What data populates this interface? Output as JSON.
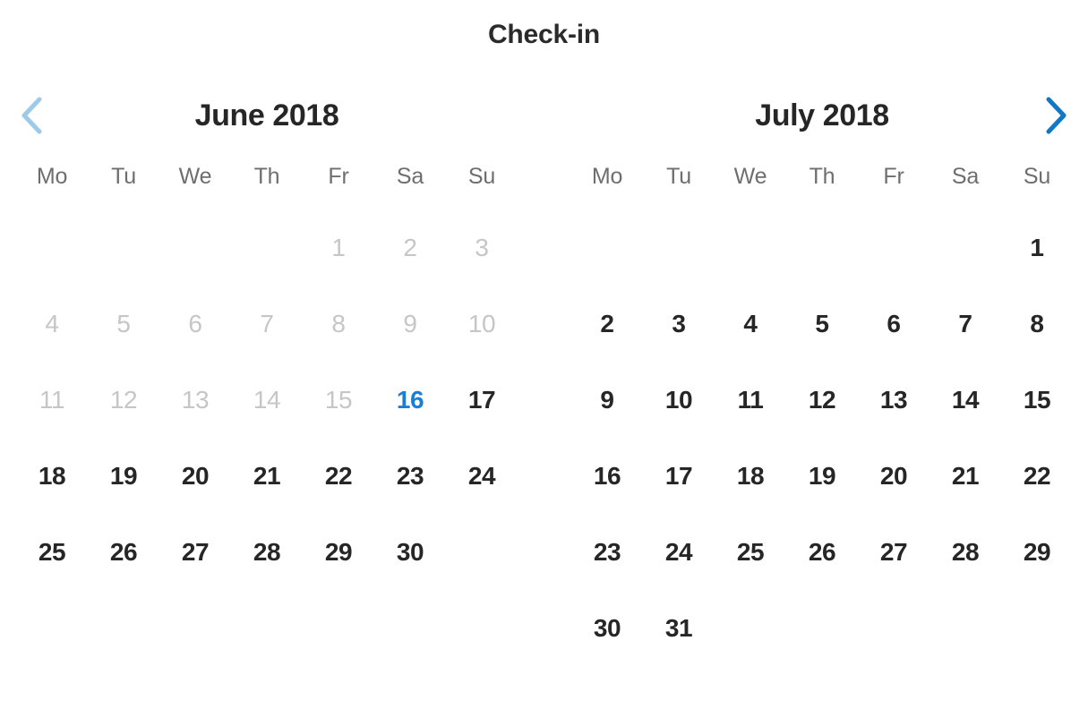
{
  "title": "Check-in",
  "colors": {
    "text_default": "#262626",
    "text_disabled": "#c6c6c6",
    "text_weekday": "#6e6e6e",
    "today_blue": "#1a7ed6",
    "arrow_next_blue": "#1179c3",
    "arrow_prev_blue": "#9ecae9",
    "background": "#ffffff"
  },
  "nav": {
    "prev": {
      "icon": "chevron-left-icon",
      "label": "Previous month",
      "enabled": false
    },
    "next": {
      "icon": "chevron-right-icon",
      "label": "Next month",
      "enabled": true
    }
  },
  "weekdays": [
    "Mo",
    "Tu",
    "We",
    "Th",
    "Fr",
    "Sa",
    "Su"
  ],
  "months": [
    {
      "caption": "June 2018",
      "weeks": [
        [
          {
            "label": "",
            "state": "empty"
          },
          {
            "label": "",
            "state": "empty"
          },
          {
            "label": "",
            "state": "empty"
          },
          {
            "label": "",
            "state": "empty"
          },
          {
            "label": "1",
            "state": "disabled"
          },
          {
            "label": "2",
            "state": "disabled"
          },
          {
            "label": "3",
            "state": "disabled"
          }
        ],
        [
          {
            "label": "4",
            "state": "disabled"
          },
          {
            "label": "5",
            "state": "disabled"
          },
          {
            "label": "6",
            "state": "disabled"
          },
          {
            "label": "7",
            "state": "disabled"
          },
          {
            "label": "8",
            "state": "disabled"
          },
          {
            "label": "9",
            "state": "disabled"
          },
          {
            "label": "10",
            "state": "disabled"
          }
        ],
        [
          {
            "label": "11",
            "state": "disabled"
          },
          {
            "label": "12",
            "state": "disabled"
          },
          {
            "label": "13",
            "state": "disabled"
          },
          {
            "label": "14",
            "state": "disabled"
          },
          {
            "label": "15",
            "state": "disabled"
          },
          {
            "label": "16",
            "state": "today"
          },
          {
            "label": "17",
            "state": "enabled"
          }
        ],
        [
          {
            "label": "18",
            "state": "enabled"
          },
          {
            "label": "19",
            "state": "enabled"
          },
          {
            "label": "20",
            "state": "enabled"
          },
          {
            "label": "21",
            "state": "enabled"
          },
          {
            "label": "22",
            "state": "enabled"
          },
          {
            "label": "23",
            "state": "enabled"
          },
          {
            "label": "24",
            "state": "enabled"
          }
        ],
        [
          {
            "label": "25",
            "state": "enabled"
          },
          {
            "label": "26",
            "state": "enabled"
          },
          {
            "label": "27",
            "state": "enabled"
          },
          {
            "label": "28",
            "state": "enabled"
          },
          {
            "label": "29",
            "state": "enabled"
          },
          {
            "label": "30",
            "state": "enabled"
          },
          {
            "label": "",
            "state": "empty"
          }
        ]
      ]
    },
    {
      "caption": "July 2018",
      "weeks": [
        [
          {
            "label": "",
            "state": "empty"
          },
          {
            "label": "",
            "state": "empty"
          },
          {
            "label": "",
            "state": "empty"
          },
          {
            "label": "",
            "state": "empty"
          },
          {
            "label": "",
            "state": "empty"
          },
          {
            "label": "",
            "state": "empty"
          },
          {
            "label": "1",
            "state": "enabled"
          }
        ],
        [
          {
            "label": "2",
            "state": "enabled"
          },
          {
            "label": "3",
            "state": "enabled"
          },
          {
            "label": "4",
            "state": "enabled"
          },
          {
            "label": "5",
            "state": "enabled"
          },
          {
            "label": "6",
            "state": "enabled"
          },
          {
            "label": "7",
            "state": "enabled"
          },
          {
            "label": "8",
            "state": "enabled"
          }
        ],
        [
          {
            "label": "9",
            "state": "enabled"
          },
          {
            "label": "10",
            "state": "enabled"
          },
          {
            "label": "11",
            "state": "enabled"
          },
          {
            "label": "12",
            "state": "enabled"
          },
          {
            "label": "13",
            "state": "enabled"
          },
          {
            "label": "14",
            "state": "enabled"
          },
          {
            "label": "15",
            "state": "enabled"
          }
        ],
        [
          {
            "label": "16",
            "state": "enabled"
          },
          {
            "label": "17",
            "state": "enabled"
          },
          {
            "label": "18",
            "state": "enabled"
          },
          {
            "label": "19",
            "state": "enabled"
          },
          {
            "label": "20",
            "state": "enabled"
          },
          {
            "label": "21",
            "state": "enabled"
          },
          {
            "label": "22",
            "state": "enabled"
          }
        ],
        [
          {
            "label": "23",
            "state": "enabled"
          },
          {
            "label": "24",
            "state": "enabled"
          },
          {
            "label": "25",
            "state": "enabled"
          },
          {
            "label": "26",
            "state": "enabled"
          },
          {
            "label": "27",
            "state": "enabled"
          },
          {
            "label": "28",
            "state": "enabled"
          },
          {
            "label": "29",
            "state": "enabled"
          }
        ],
        [
          {
            "label": "30",
            "state": "enabled"
          },
          {
            "label": "31",
            "state": "enabled"
          },
          {
            "label": "",
            "state": "empty"
          },
          {
            "label": "",
            "state": "empty"
          },
          {
            "label": "",
            "state": "empty"
          },
          {
            "label": "",
            "state": "empty"
          },
          {
            "label": "",
            "state": "empty"
          }
        ]
      ]
    }
  ]
}
